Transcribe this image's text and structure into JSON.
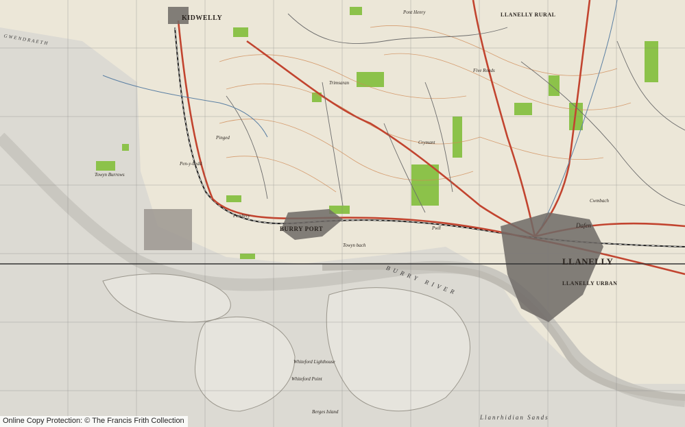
{
  "map": {
    "places": {
      "kidwelly": "KIDWELLY",
      "burry_port": "BURRY PORT",
      "llanelly": "LLANELLY",
      "llanelly_urban": "LLANELLY URBAN",
      "llanelly_rural": "LLANELLY RURAL",
      "pembrey": "Pembrey",
      "pinged": "Pinged",
      "dafen": "Dafen",
      "five_roads": "Five Roads",
      "pont_henry": "Pont Henry",
      "towyn_burrows": "Towyn Burrows",
      "trimsaran": "Trimsaran",
      "pwll": "Pwll",
      "penybedd": "Pen-y-bedd",
      "crymant": "Crymant",
      "cwmbach": "Cwmbach"
    },
    "water": {
      "burry_river": "BURRY RIVER",
      "llanrhidian_sands": "Llanrhidian Sands",
      "gwendraeth": "GWENDRAETH",
      "whiteford_point": "Whiteford Point",
      "whiteford_lighthouse": "Whiteford Lighthouse",
      "berges_island": "Berges Island",
      "towyn_bach": "Towyn bach"
    },
    "colors": {
      "land": "#ece7d8",
      "sand": "#d9d6cc",
      "woodland": "#8cc24a",
      "contour": "#d08a55",
      "road_main": "#c2442f",
      "rail": "#222222",
      "urban": "#6f6a66",
      "grid": "#7a7a7a"
    }
  },
  "footer": {
    "text": "Online Copy Protection: © The Francis Frith Collection"
  }
}
